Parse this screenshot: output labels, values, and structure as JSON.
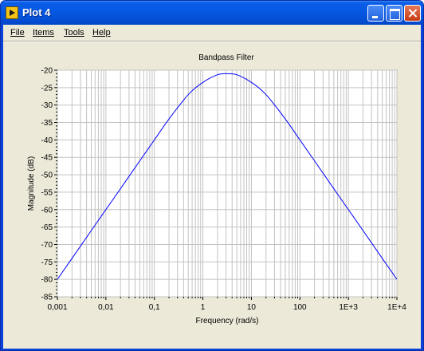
{
  "window": {
    "title": "Plot 4"
  },
  "menu": {
    "file": "File",
    "items": "Items",
    "tools": "Tools",
    "help": "Help"
  },
  "colors": {
    "titlebar": "#0558e2",
    "client_background": "#ece9d8",
    "plot_background": "#ffffff",
    "grid": "#c3c3c3",
    "trace": "#0000ff"
  },
  "chart_data": {
    "type": "line",
    "title": "Bandpass Filter",
    "xlabel": "Frequency (rad/s)",
    "ylabel": "Magnitude (dB)",
    "x_scale": "log",
    "xlim": [
      0.001,
      10000
    ],
    "ylim": [
      -85,
      -20
    ],
    "grid": true,
    "x_ticks": [
      "0,001",
      "0,01",
      "0,1",
      "1",
      "10",
      "100",
      "1E+3",
      "1E+4"
    ],
    "y_ticks": [
      "-20",
      "-25",
      "-30",
      "-35",
      "-40",
      "-45",
      "-50",
      "-55",
      "-60",
      "-65",
      "-70",
      "-75",
      "-80",
      "-85"
    ],
    "series": [
      {
        "color": "#0000ff",
        "x": [
          0.001,
          0.002,
          0.005,
          0.01,
          0.02,
          0.05,
          0.1,
          0.2,
          0.5,
          1,
          2,
          3.16,
          5,
          10,
          20,
          50,
          100,
          200,
          500,
          1000,
          2000,
          5000,
          10000
        ],
        "y": [
          -80,
          -74,
          -66,
          -60,
          -54,
          -46,
          -40,
          -34,
          -27,
          -23.5,
          -21.3,
          -21,
          -21.3,
          -23.5,
          -27,
          -34,
          -40,
          -46,
          -54,
          -60,
          -66,
          -74,
          -80
        ]
      }
    ]
  }
}
